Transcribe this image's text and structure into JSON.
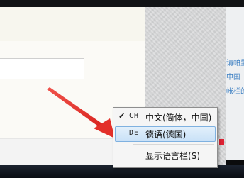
{
  "side_panel": {
    "snippets": [
      "请帕里",
      "中国",
      "帐栏的"
    ]
  },
  "language_menu": {
    "items": [
      {
        "code": "CH",
        "label": "中文(简体，中国)",
        "checked": true
      },
      {
        "code": "DE",
        "label": "德语(德国)",
        "checked": false,
        "highlighted": true
      }
    ],
    "show_language_bar": {
      "label": "显示语言栏",
      "shortcut": "(S)"
    },
    "checkmark": "✔"
  },
  "colors": {
    "arrow": "#e8312d",
    "highlight_border": "#7fb1e0",
    "highlight_fill": "#c9e1f7"
  }
}
